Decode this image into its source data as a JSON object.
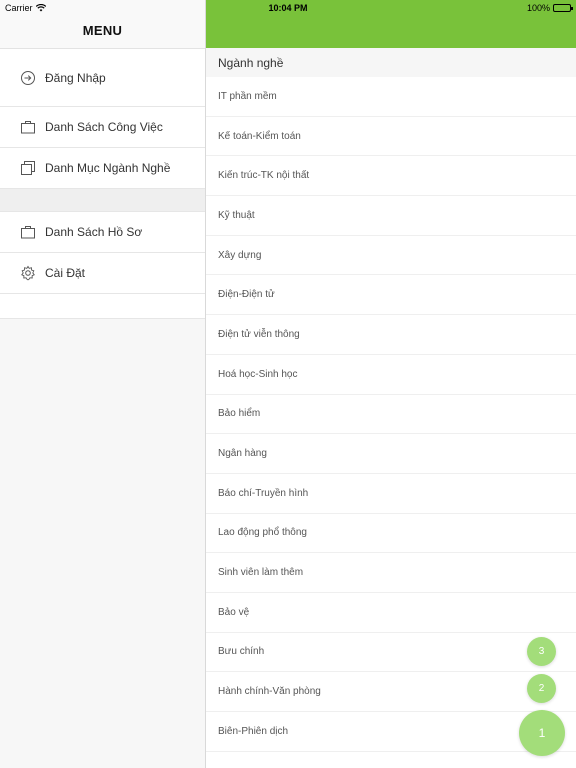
{
  "status_bar": {
    "carrier": "Carrier",
    "time": "10:04 PM",
    "battery": "100%"
  },
  "side_menu": {
    "title": "MENU",
    "items": [
      {
        "label": "Đăng Nhập",
        "icon": "login-icon"
      },
      {
        "label": "Danh Sách Công Việc",
        "icon": "briefcase-icon"
      },
      {
        "label": "Danh Mục Ngành Nghề",
        "icon": "copy-icon"
      },
      {
        "label": "Danh Sách Hồ Sơ",
        "icon": "briefcase-icon"
      },
      {
        "label": "Cài Đặt",
        "icon": "gear-icon"
      }
    ]
  },
  "main": {
    "header_color": "#79c23a",
    "section_title": "Ngành nghề",
    "categories": [
      "IT phần mềm",
      "Kế toán-Kiểm toán",
      "Kiến trúc-TK nội thất",
      "Kỹ thuật",
      "Xây dựng",
      "Điện-Điện tử",
      "Điện tử viễn thông",
      "Hoá học-Sinh học",
      "Bảo hiểm",
      "Ngân hàng",
      "Báo chí-Truyền hình",
      "Lao động phổ thông",
      "Sinh viên làm thêm",
      "Bảo vệ",
      "Bưu chính",
      "Hành chính-Văn phòng",
      "Biên-Phiên dịch"
    ]
  },
  "fabs": {
    "fab_3": "3",
    "fab_2": "2",
    "fab_1": "1"
  }
}
